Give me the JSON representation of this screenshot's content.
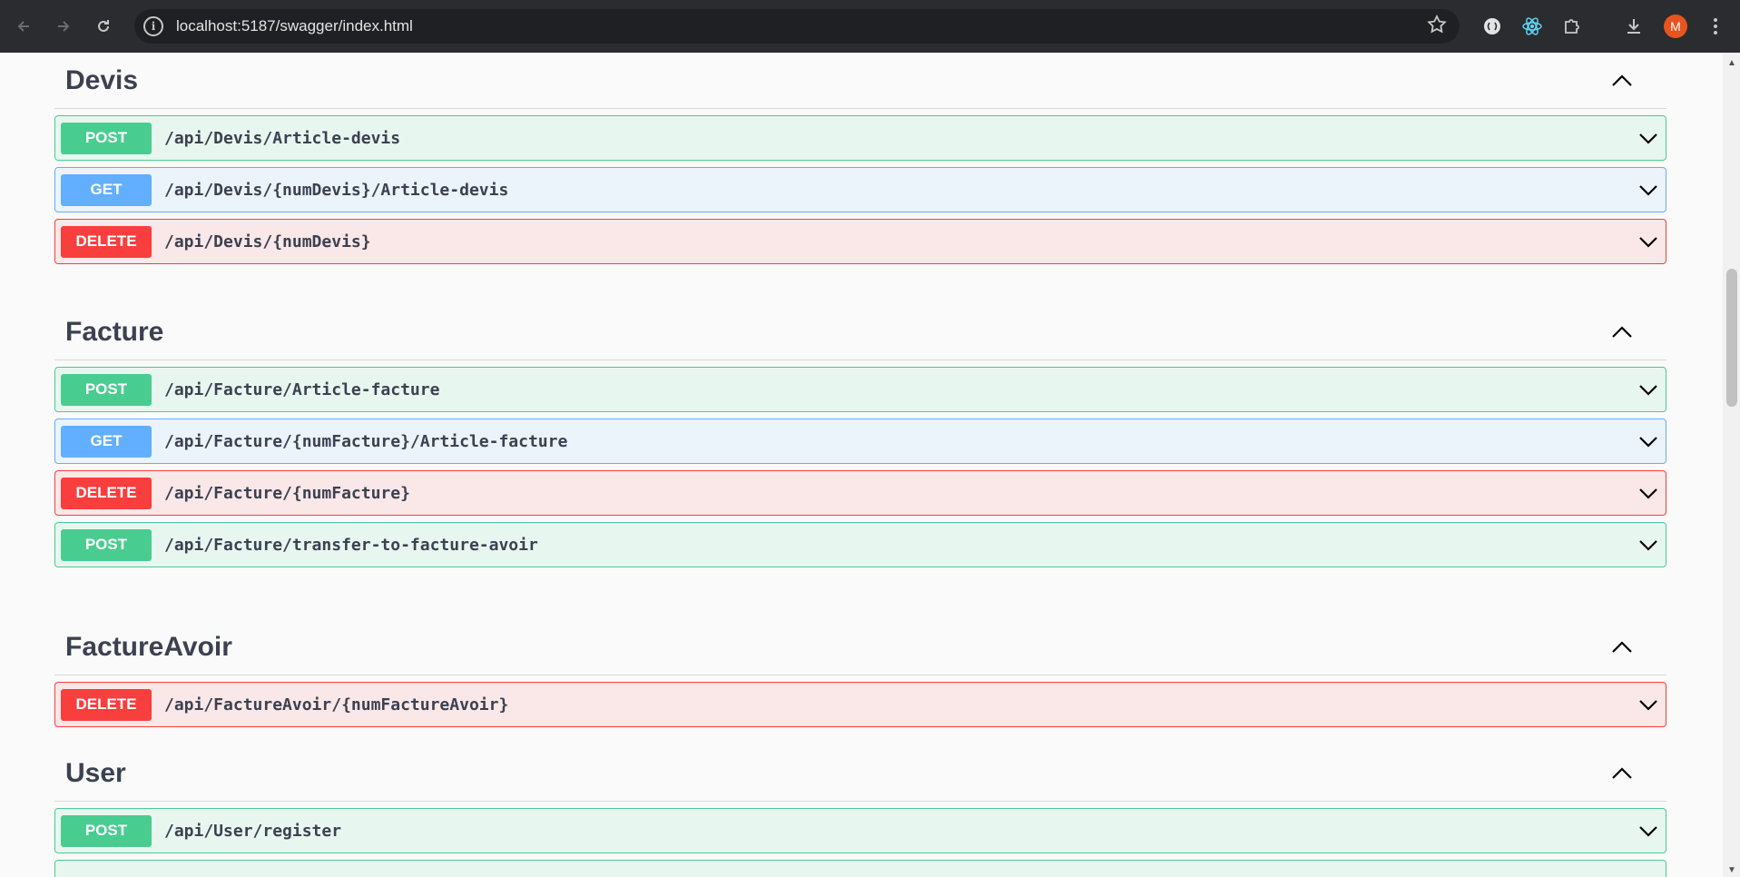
{
  "browser": {
    "url": "localhost:5187/swagger/index.html",
    "avatar_initial": "M",
    "icons": [
      "back-icon",
      "forward-icon",
      "reload-icon",
      "site-info-icon",
      "bookmark-star-icon",
      "extension-icon",
      "react-devtools-icon",
      "puzzle-extensions-icon",
      "download-icon",
      "menu-icon"
    ]
  },
  "sections": [
    {
      "title": "Devis",
      "operations": [
        {
          "method": "POST",
          "path": "/api/Devis/Article-devis"
        },
        {
          "method": "GET",
          "path": "/api/Devis/{numDevis}/Article-devis"
        },
        {
          "method": "DELETE",
          "path": "/api/Devis/{numDevis}"
        }
      ]
    },
    {
      "title": "Facture",
      "operations": [
        {
          "method": "POST",
          "path": "/api/Facture/Article-facture"
        },
        {
          "method": "GET",
          "path": "/api/Facture/{numFacture}/Article-facture"
        },
        {
          "method": "DELETE",
          "path": "/api/Facture/{numFacture}"
        },
        {
          "method": "POST",
          "path": "/api/Facture/transfer-to-facture-avoir"
        }
      ]
    },
    {
      "title": "FactureAvoir",
      "operations": [
        {
          "method": "DELETE",
          "path": "/api/FactureAvoir/{numFactureAvoir}"
        }
      ]
    },
    {
      "title": "User",
      "operations": [
        {
          "method": "POST",
          "path": "/api/User/register"
        }
      ]
    }
  ],
  "colors": {
    "post": "#49cc90",
    "get": "#61affe",
    "delete": "#f93e3e",
    "title": "#3b4151"
  }
}
